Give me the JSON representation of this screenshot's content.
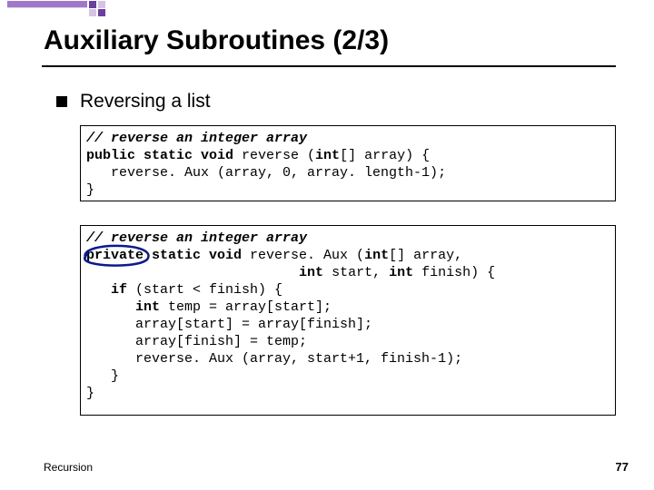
{
  "title": "Auxiliary Subroutines (2/3)",
  "bullet": "Reversing a list",
  "code1": {
    "l1a": "// reverse an integer array",
    "l2a": "public static void",
    "l2b": " reverse (",
    "l2c": "int",
    "l2d": "[] array) {",
    "l3": "   reverse. Aux (array, 0, array. length-1);",
    "l4": "}"
  },
  "code2": {
    "l1a": "// reverse an integer array",
    "l2a": "private static void",
    "l2b": " reverse. Aux (",
    "l2c": "int",
    "l2d": "[] array,",
    "l3a": "                          ",
    "l3b": "int",
    "l3c": " start, ",
    "l3d": "int",
    "l3e": " finish) {",
    "l4a": "   ",
    "l4b": "if",
    "l4c": " (start < finish) {",
    "l5a": "      ",
    "l5b": "int",
    "l5c": " temp = array[start];",
    "l6": "      array[start] = array[finish];",
    "l7": "      array[finish] = temp;",
    "l8": "      reverse. Aux (array, start+1, finish-1);",
    "l9": "   }",
    "l10": "}"
  },
  "footer": {
    "topic": "Recursion",
    "page": "77"
  }
}
